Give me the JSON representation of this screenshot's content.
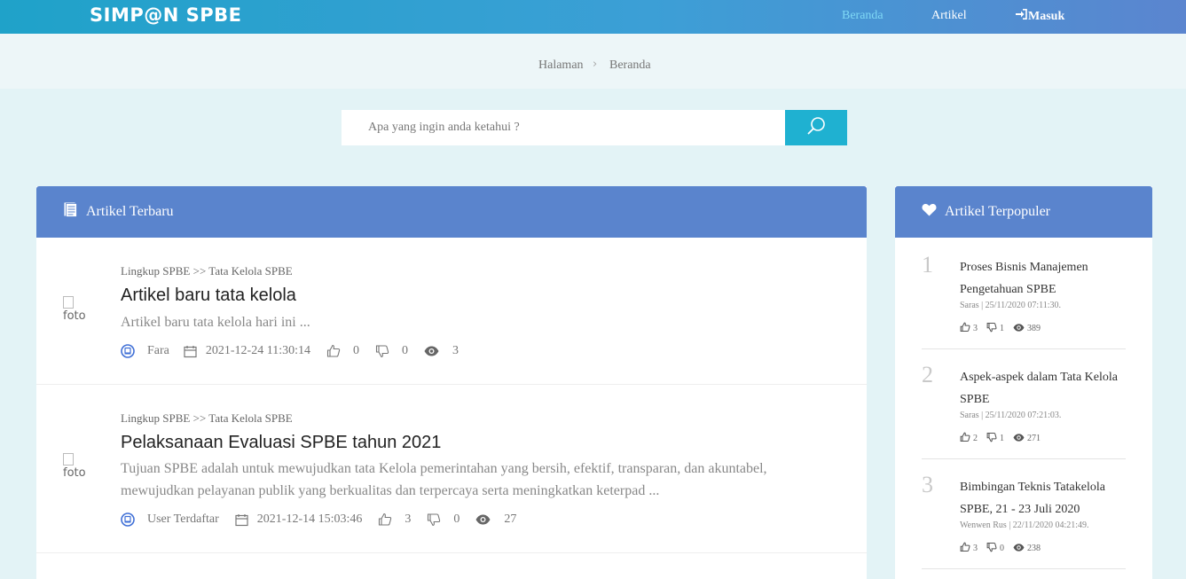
{
  "nav": {
    "brand": "SIMP@N SPBE",
    "beranda": "Beranda",
    "artikel": "Artikel",
    "masuk": "Masuk"
  },
  "breadcrumb": {
    "halaman": "Halaman",
    "beranda": "Beranda"
  },
  "search": {
    "placeholder": "Apa yang ingin anda ketahui ?"
  },
  "latest": {
    "title": "Artikel Terbaru",
    "items": [
      {
        "foto_alt": "foto",
        "category": "Lingkup SPBE >> Tata Kelola SPBE",
        "title": "Artikel baru tata kelola",
        "excerpt": "Artikel baru tata kelola hari ini ...",
        "author": "Fara",
        "date": "2021-12-24 11:30:14",
        "likes": "0",
        "dislikes": "0",
        "views": "3"
      },
      {
        "foto_alt": "foto",
        "category": "Lingkup SPBE >> Tata Kelola SPBE",
        "title": "Pelaksanaan Evaluasi SPBE tahun 2021",
        "excerpt": "Tujuan SPBE adalah untuk mewujudkan tata Kelola pemerintahan yang bersih, efektif, transparan, dan akuntabel, mewujudkan pelayanan publik yang berkualitas dan terpercaya serta meningkatkan keterpad ...",
        "author": "User Terdaftar",
        "date": "2021-12-14 15:03:46",
        "likes": "3",
        "dislikes": "0",
        "views": "27"
      }
    ]
  },
  "popular": {
    "title": "Artikel Terpopuler",
    "items": [
      {
        "rank": "1",
        "title": "Proses Bisnis Manajemen Pengetahuan SPBE",
        "byline": "Saras | 25/11/2020 07:11:30.",
        "likes": "3",
        "dislikes": "1",
        "views": "389"
      },
      {
        "rank": "2",
        "title": "Aspek-aspek dalam Tata Kelola SPBE",
        "byline": "Saras | 25/11/2020 07:21:03.",
        "likes": "2",
        "dislikes": "1",
        "views": "271"
      },
      {
        "rank": "3",
        "title": "Bimbingan Teknis Tatakelola SPBE, 21 - 23 Juli 2020",
        "byline": "Wenwen Rus | 22/11/2020 04:21:49.",
        "likes": "3",
        "dislikes": "0",
        "views": "238"
      }
    ]
  },
  "colors": {
    "nav_gradient_start": "#1fa2c9",
    "nav_gradient_end": "#5b85cf",
    "panel_header": "#5a84cd",
    "search_button": "#1fb1d1",
    "active_nav": "#7fd8f5",
    "page_background": "#e3f3f6"
  },
  "icons": {
    "search": "search-icon",
    "login": "sign-in-icon",
    "document": "document-icon",
    "heart": "heart-icon",
    "user": "user-icon",
    "calendar": "calendar-icon",
    "like": "thumbs-up-icon",
    "dislike": "thumbs-down-icon",
    "views": "eye-icon"
  }
}
